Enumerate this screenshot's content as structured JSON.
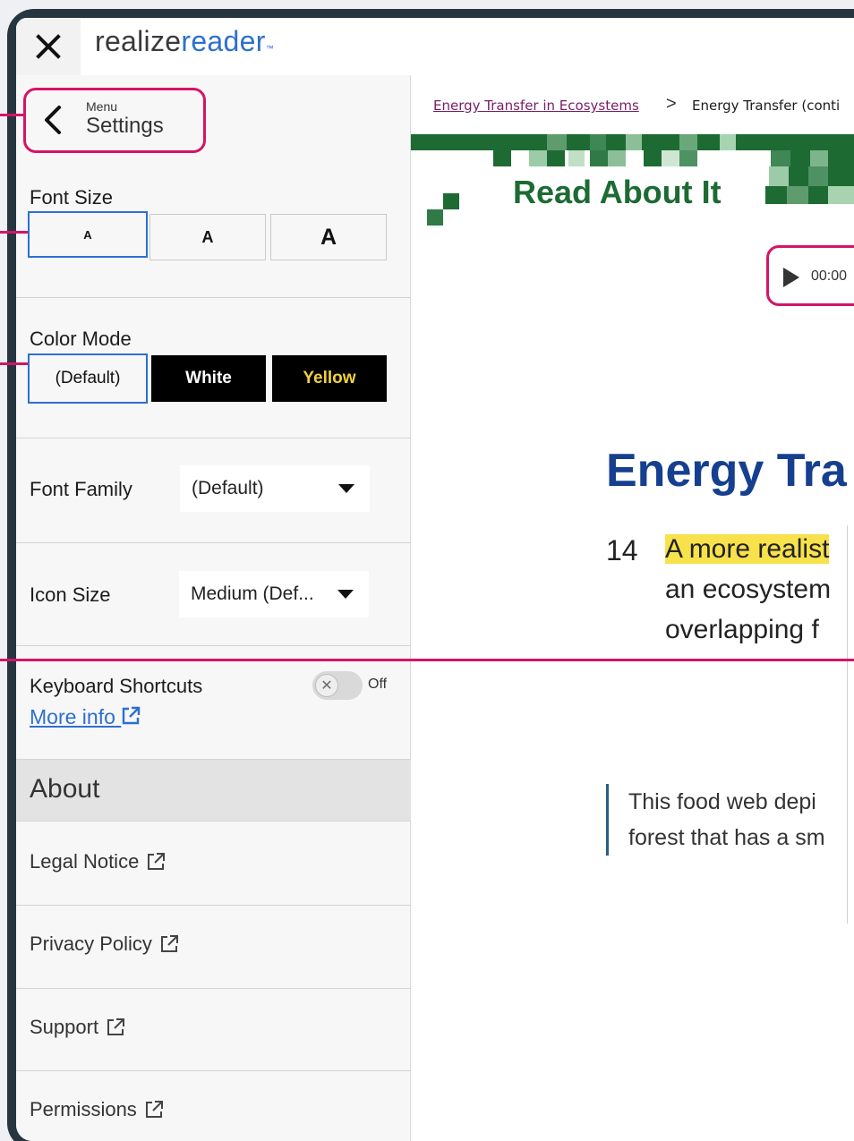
{
  "app": {
    "logo_part1": "realize",
    "logo_part2": "reader",
    "logo_tm": "™"
  },
  "panel": {
    "header_small": "Menu",
    "header_big": "Settings",
    "font_size": {
      "label": "Font Size",
      "options": [
        "A",
        "A",
        "A"
      ],
      "selected_index": 0
    },
    "color_mode": {
      "label": "Color Mode",
      "options": [
        "(Default)",
        "White",
        "Yellow"
      ],
      "selected_index": 0
    },
    "font_family": {
      "label": "Font Family",
      "value": "(Default)"
    },
    "icon_size": {
      "label": "Icon Size",
      "value": "Medium (Def..."
    },
    "keyboard_shortcuts": {
      "label": "Keyboard Shortcuts",
      "state": "Off",
      "more_info": "More info"
    },
    "about": "About",
    "links": [
      "Legal Notice",
      "Privacy Policy",
      "Support",
      "Permissions"
    ]
  },
  "content": {
    "breadcrumb_parent": "Energy Transfer in Ecosystems",
    "breadcrumb_current": "Energy Transfer (conti",
    "section_banner": "Read About It",
    "audio_time": "00:00",
    "heading": "Energy Tra",
    "paragraph_number": "14",
    "paragraph_lines": [
      "A more realist",
      "an ecosystem",
      "overlapping f"
    ],
    "caption_lines": [
      "This food web depi",
      "forest that has a sm"
    ]
  },
  "colors": {
    "accent_blue": "#2d6fd1",
    "highlight_magenta": "#d41467",
    "banner_green": "#1d6b33",
    "heading_navy": "#163f8f",
    "text_highlight": "#f7e24c"
  }
}
